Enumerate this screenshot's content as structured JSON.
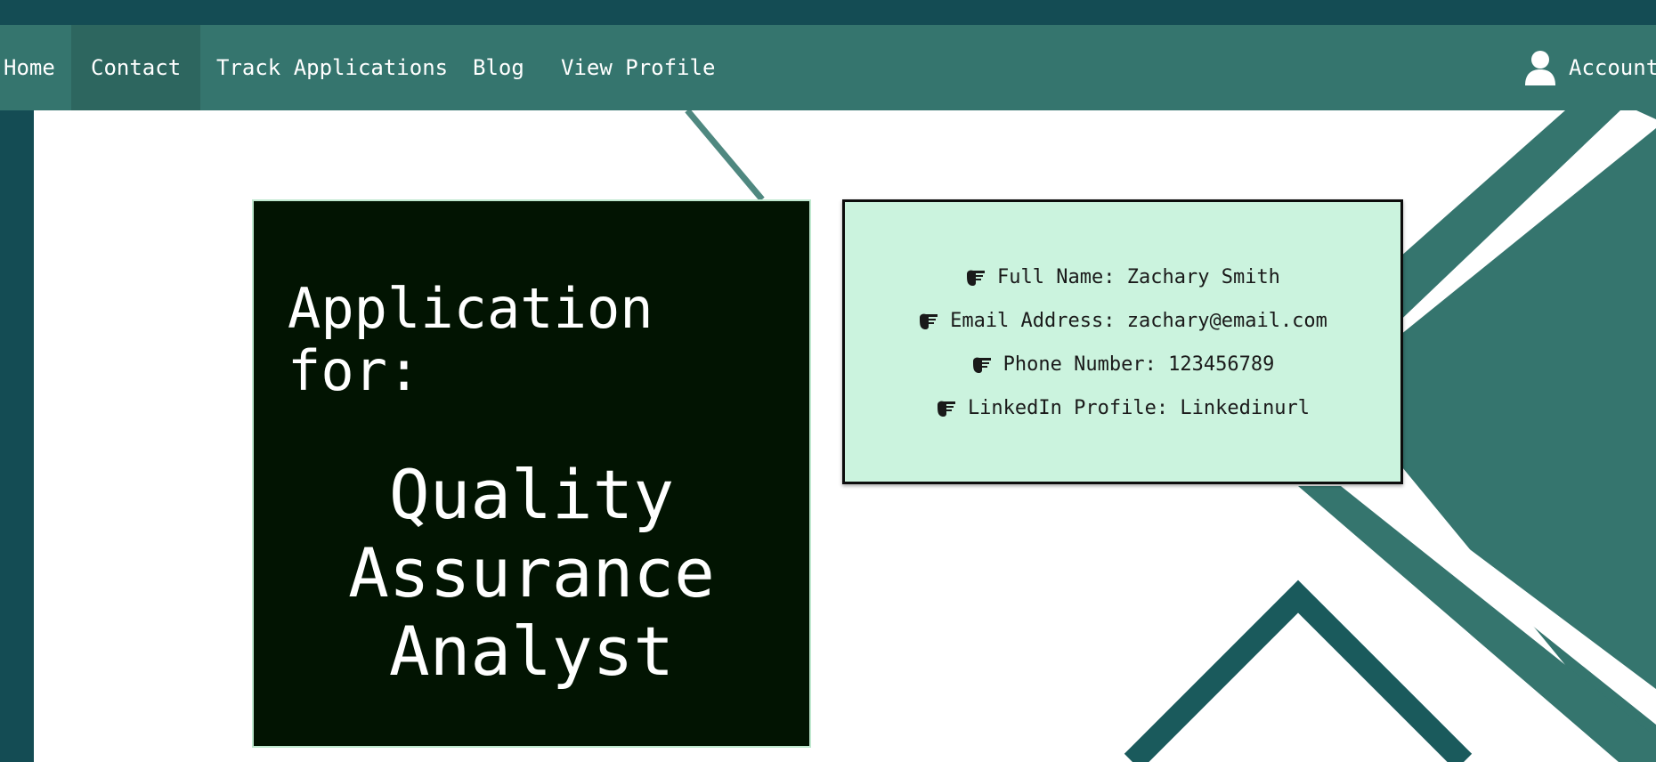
{
  "nav": {
    "items": [
      {
        "label": "Home"
      },
      {
        "label": "Contact"
      },
      {
        "label": "Track Applications"
      },
      {
        "label": "Blog"
      },
      {
        "label": "View Profile"
      }
    ],
    "active": "Contact",
    "account_label": "Account"
  },
  "application": {
    "label": "Application for:",
    "job_title": "Quality Assurance Analyst"
  },
  "contact": {
    "rows": [
      {
        "text": "Full Name: Zachary Smith",
        "icon": "hand-pointer-icon"
      },
      {
        "text": "Email Address: zachary@email.com",
        "icon": "hand-pointer-icon"
      },
      {
        "text": "Phone Number: 123456789",
        "icon": "hand-pointer-icon"
      },
      {
        "text": "LinkedIn Profile: Linkedinurl",
        "icon": "hand-pointer-icon"
      }
    ]
  },
  "colors": {
    "nav_bg": "#35756e",
    "top_strip": "#144c54",
    "title_card_bg": "#021402",
    "contact_card_bg": "#cbf3de"
  }
}
